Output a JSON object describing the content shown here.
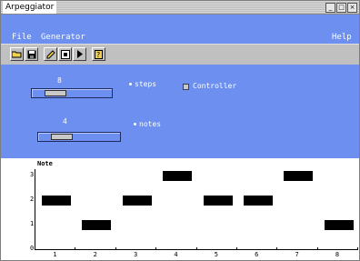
{
  "window": {
    "title": "Arpeggiator",
    "controls": [
      "_",
      "□",
      "×"
    ]
  },
  "menu": {
    "file": "File",
    "generator": "Generator",
    "help": "Help"
  },
  "toolbar": {
    "buttons": [
      "open-icon",
      "save-icon",
      "pencil-icon",
      "grid-icon",
      "play-icon",
      "help-icon"
    ]
  },
  "controls": {
    "steps_value": "8",
    "steps_label": "steps",
    "steps_level": 0.2,
    "controller_label": "Controller",
    "notes_value": "4",
    "notes_label": "notes",
    "notes_level": 0.2
  },
  "chart_data": {
    "type": "bar",
    "ylabel": "Note",
    "x": [
      1,
      2,
      3,
      4,
      5,
      6,
      7,
      8
    ],
    "values": [
      2,
      1,
      2,
      3,
      2,
      2,
      3,
      1
    ],
    "x_ticks": [
      "1",
      "2",
      "3",
      "4",
      "5",
      "6",
      "7",
      "8"
    ],
    "y_ticks": [
      "0",
      "1",
      "2",
      "3"
    ],
    "ylim": [
      0,
      3.5
    ]
  }
}
